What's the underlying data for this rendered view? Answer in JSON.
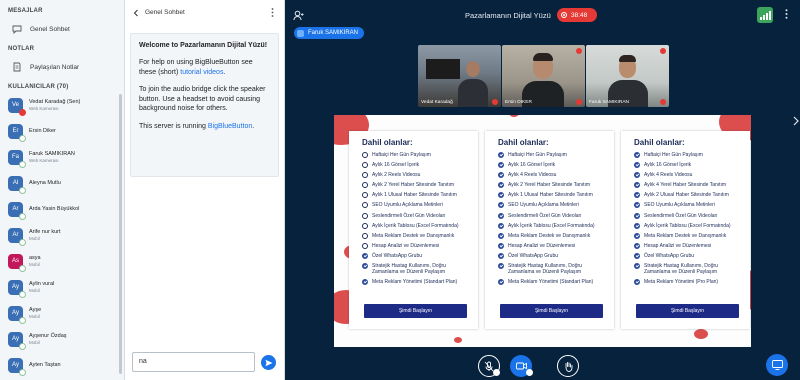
{
  "sidebar": {
    "messages_title": "MESAJLAR",
    "public_chat": "Genel Sohbet",
    "notes_title": "NOTLAR",
    "shared_notes": "Paylaşılan Notlar",
    "users_title": "KULLANICILAR (70)",
    "users": [
      {
        "initials": "Ve",
        "name": "Vedat Karadağ (Sen)",
        "sub": "Web Kamerası",
        "color": "#3a6fb5"
      },
      {
        "initials": "Er",
        "name": "Ersin Diker",
        "sub": "",
        "color": "#3a6fb5"
      },
      {
        "initials": "Fa",
        "name": "Faruk SAMIKIRAN",
        "sub": "Web Kamerası",
        "color": "#3a6fb5"
      },
      {
        "initials": "Al",
        "name": "Aleyna Mutlu",
        "sub": "",
        "color": "#3a6fb5"
      },
      {
        "initials": "Ar",
        "name": "Arda Yasin Büyükkol",
        "sub": "",
        "color": "#3a6fb5"
      },
      {
        "initials": "Ar",
        "name": "Arife nur kurt",
        "sub": "Mobil",
        "color": "#3a6fb5"
      },
      {
        "initials": "As",
        "name": "asya",
        "sub": "Mobil",
        "color": "#c2185b"
      },
      {
        "initials": "Ay",
        "name": "Aylin vural",
        "sub": "Mobil",
        "color": "#3a6fb5"
      },
      {
        "initials": "Ay",
        "name": "Ayşe",
        "sub": "Mobil",
        "color": "#3a6fb5"
      },
      {
        "initials": "Ay",
        "name": "Ayşenur Özdaş",
        "sub": "Mobil",
        "color": "#3a6fb5"
      },
      {
        "initials": "Ay",
        "name": "Ayten Taştan",
        "sub": "",
        "color": "#3a6fb5"
      }
    ]
  },
  "chat": {
    "header": "Genel Sohbet",
    "welcome_title": "Welcome to Pazarlamanın Dijital Yüzü!",
    "help_prefix": "For help on using BigBlueButton see these (short) ",
    "help_link": "tutorial videos",
    "help_suffix": ".",
    "audio_text": "To join the audio bridge click the speaker button. Use a headset to avoid causing background noise for others.",
    "running_prefix": "This server is running ",
    "running_link": "BigBlueButton",
    "running_suffix": ".",
    "input_value": "na"
  },
  "meeting": {
    "title": "Pazarlamanın Dijital Yüzü",
    "timer": "38:48",
    "presenter": "Faruk SAMIKIRAN",
    "videos": [
      {
        "name": "Vedat Karadağ"
      },
      {
        "name": "Ersin DIKER"
      },
      {
        "name": "Faruk SAMIKIRAN"
      }
    ]
  },
  "slide": {
    "cards": [
      {
        "title": "Dahil olanlar:",
        "cta": "Şimdi Başlayın",
        "features": [
          {
            "text": "Haftaiçi Her Gün Paylaşım",
            "checked": false
          },
          {
            "text": "Aylık 16 Görsel İçerik",
            "checked": false
          },
          {
            "text": "Aylık 2 Reels Videosu",
            "checked": false
          },
          {
            "text": "Aylık 2 Yerel Haber Sitesinde Tanıtım",
            "checked": false
          },
          {
            "text": "Aylık 1 Ulusal Haber Sitesinde Tanıtım",
            "checked": false
          },
          {
            "text": "SEO Uyumlu Açıklama Metinleri",
            "checked": false
          },
          {
            "text": "Seslendirmeli Özel Gün Videoları",
            "checked": false
          },
          {
            "text": "Aylık İçerik Tablosu (Excel Formatında)",
            "checked": false
          },
          {
            "text": "Meta Reklam Destek ve Danışmanlık",
            "checked": false
          },
          {
            "text": "Hesap Analizi ve Düzenlemesi",
            "checked": false
          },
          {
            "text": "Özel WhatsApp Grubu",
            "checked": true
          },
          {
            "text": "Stratejik Hastag Kullanımı, Doğru Zamanlama ve Düzenli Paylaşım",
            "checked": true
          },
          {
            "text": "Meta Reklam Yönetimi (Standart Plan)",
            "checked": true
          }
        ]
      },
      {
        "title": "Dahil olanlar:",
        "cta": "Şimdi Başlayın",
        "features": [
          {
            "text": "Haftaiçi Her Gün Paylaşım",
            "checked": true
          },
          {
            "text": "Aylık 16 Görsel İçerik",
            "checked": true
          },
          {
            "text": "Aylık 4 Reels Videosu",
            "checked": true
          },
          {
            "text": "Aylık 2 Yerel Haber Sitesinde Tanıtım",
            "checked": true
          },
          {
            "text": "Aylık 1 Ulusal Haber Sitesinde Tanıtım",
            "checked": true
          },
          {
            "text": "SEO Uyumlu Açıklama Metinleri",
            "checked": true
          },
          {
            "text": "Seslendirmeli Özel Gün Videoları",
            "checked": true
          },
          {
            "text": "Aylık İçerik Tablosu (Excel Formatında)",
            "checked": true
          },
          {
            "text": "Meta Reklam Destek ve Danışmanlık",
            "checked": true
          },
          {
            "text": "Hesap Analizi ve Düzenlemesi",
            "checked": true
          },
          {
            "text": "Özel WhatsApp Grubu",
            "checked": true
          },
          {
            "text": "Stratejik Hastag Kullanımı, Doğru Zamanlama ve Düzenli Paylaşım",
            "checked": true
          },
          {
            "text": "Meta Reklam Yönetimi (Standart Plan)",
            "checked": true
          }
        ]
      },
      {
        "title": "Dahil olanlar:",
        "cta": "Şimdi Başlayın",
        "features": [
          {
            "text": "Haftaiçi Her Gün Paylaşım",
            "checked": true
          },
          {
            "text": "Aylık 16 Görsel İçerik",
            "checked": true
          },
          {
            "text": "Aylık 4 Reels Videosu",
            "checked": true
          },
          {
            "text": "Aylık 4 Yerel Haber Sitesinde Tanıtım",
            "checked": true
          },
          {
            "text": "Aylık 2 Ulusal Haber Sitesinde Tanıtım",
            "checked": true
          },
          {
            "text": "SEO Uyumlu Açıklama Metinleri",
            "checked": true
          },
          {
            "text": "Seslendirmeli Özel Gün Videoları",
            "checked": true
          },
          {
            "text": "Aylık İçerik Tablosu (Excel Formatında)",
            "checked": true
          },
          {
            "text": "Meta Reklam Destek ve Danışmanlık",
            "checked": true
          },
          {
            "text": "Hesap Analizi ve Düzenlemesi",
            "checked": true
          },
          {
            "text": "Özel WhatsApp Grubu",
            "checked": true
          },
          {
            "text": "Stratejik Hastag Kullanımı, Doğru Zamanlama ve Düzenli Paylaşım",
            "checked": true
          },
          {
            "text": "Meta Reklam Yönetimi (Pro Plan)",
            "checked": true
          }
        ]
      }
    ]
  },
  "colors": {
    "accent": "#1a73e8",
    "stage_bg": "#07223d",
    "record": "#e53935",
    "connection": "#3ba55c",
    "cta": "#1d2a86"
  },
  "icons": [
    "chat-icon",
    "notes-icon",
    "back-chevron-icon",
    "kebab-icon",
    "user-icon",
    "record-icon",
    "connection-icon",
    "mic-off-icon",
    "camera-icon",
    "hand-icon",
    "send-icon",
    "share-icon",
    "next-arrow-icon"
  ]
}
